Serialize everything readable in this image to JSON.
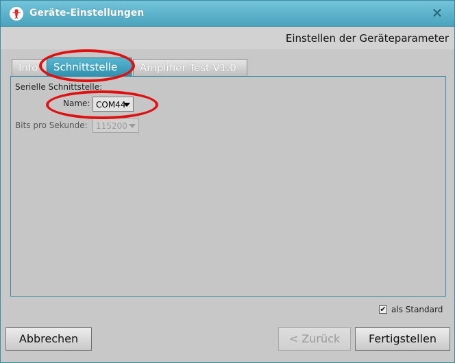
{
  "window": {
    "title": "Geräte-Einstellungen",
    "close_symbol": "✕",
    "app_icon": "person-logo-icon"
  },
  "header": {
    "title": "Einstellen der Geräteparameter"
  },
  "tabs": [
    {
      "label": "Info",
      "active": false
    },
    {
      "label": "Schnittstelle",
      "active": true
    },
    {
      "label": "Amplifier Test V1.0",
      "active": false
    }
  ],
  "serial": {
    "group_label": "Serielle Schnittstelle:",
    "name_label": "Name:",
    "name_value": "COM44",
    "baud_label": "Bits pro Sekunde:",
    "baud_value": "115200"
  },
  "default_checkbox": {
    "checked": true,
    "mark": "✔",
    "label": "als Standard"
  },
  "buttons": {
    "cancel": "Abbrechen",
    "back": "< Zurück",
    "finish": "Fertigstellen"
  },
  "colors": {
    "title_bar": "#4aa3bd",
    "active_tab": "#2f8fae",
    "annotation": "#e01010"
  }
}
